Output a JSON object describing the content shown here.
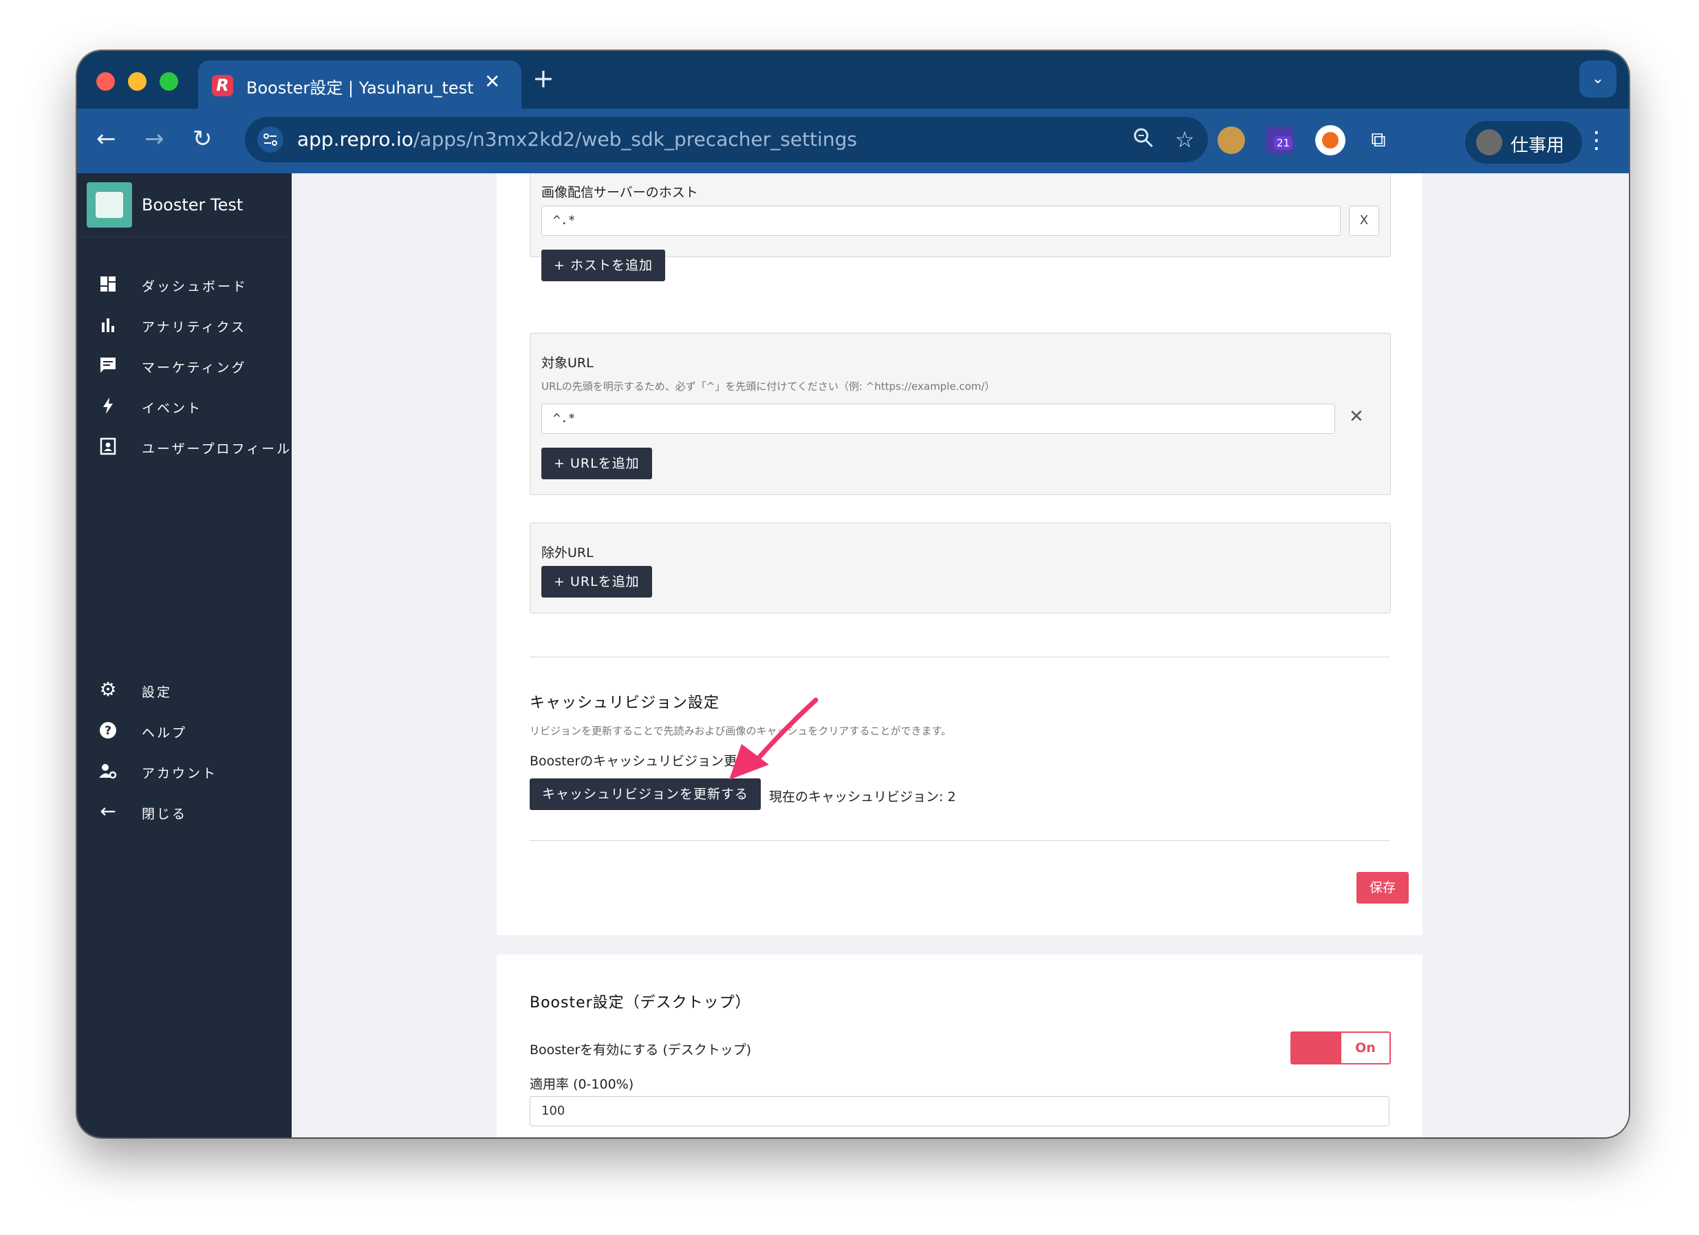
{
  "browser": {
    "tab_title": "Booster設定 | Yasuharu_test",
    "tab_logo_letter": "R",
    "url_host": "app.repro.io",
    "url_path": "/apps/n3mx2kd2/web_sdk_precacher_settings",
    "extension_badge": "21",
    "profile_name": "仕事用"
  },
  "sidebar": {
    "app_name": "Booster Test",
    "items": [
      {
        "label": "ダッシュボード",
        "icon": "dashboard-icon"
      },
      {
        "label": "アナリティクス",
        "icon": "bar-chart-icon"
      },
      {
        "label": "マーケティング",
        "icon": "message-icon"
      },
      {
        "label": "イベント",
        "icon": "bolt-icon"
      },
      {
        "label": "ユーザープロフィール",
        "icon": "profile-icon"
      }
    ],
    "bottom_items": [
      {
        "label": "設定",
        "icon": "gear-icon"
      },
      {
        "label": "ヘルプ",
        "icon": "help-icon"
      },
      {
        "label": "アカウント",
        "icon": "account-settings-icon"
      },
      {
        "label": "閉じる",
        "icon": "arrow-left-icon"
      }
    ]
  },
  "image_host": {
    "label": "画像配信サーバーのホスト",
    "value": "^.*",
    "remove_label": "X",
    "add_button": "+ ホストを追加"
  },
  "target_url": {
    "label": "対象URL",
    "hint": "URLの先頭を明示するため、必ず「^」を先頭に付けてください（例: ^https://example.com/）",
    "value": "^.*",
    "remove_label": "✕",
    "add_button": "+ URLを追加"
  },
  "exclude_url": {
    "label": "除外URL",
    "add_button": "+ URLを追加"
  },
  "cache_revision": {
    "title": "キャッシュリビジョン設定",
    "description": "リビジョンを更新することで先読みおよび画像のキャッシュをクリアすることができます。",
    "field_label": "Boosterのキャッシュリビジョン更新",
    "update_button": "キャッシュリビジョンを更新する",
    "current_revision": "現在のキャッシュリビジョン: 2"
  },
  "save_button": "保存",
  "desktop": {
    "title": "Booster設定（デスクトップ）",
    "enable_label": "Boosterを有効にする (デスクトップ)",
    "toggle_state": "On",
    "rate_label": "適用率 (0-100%)",
    "rate_value": "100"
  },
  "colors": {
    "accent": "#e94b63",
    "sidebar_bg": "#1f2a3a",
    "chrome_blue": "#1d5797",
    "annotation_arrow": "#f0346b"
  }
}
